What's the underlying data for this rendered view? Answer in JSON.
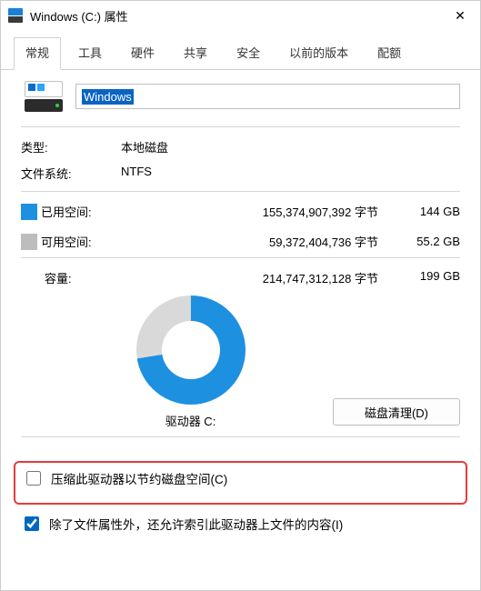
{
  "window": {
    "title": "Windows (C:) 属性"
  },
  "tabs": {
    "items": [
      {
        "label": "常规"
      },
      {
        "label": "工具"
      },
      {
        "label": "硬件"
      },
      {
        "label": "共享"
      },
      {
        "label": "安全"
      },
      {
        "label": "以前的版本"
      },
      {
        "label": "配额"
      }
    ],
    "active_index": 0
  },
  "drive": {
    "name": "Windows",
    "type_label": "类型:",
    "type_value": "本地磁盘",
    "fs_label": "文件系统:",
    "fs_value": "NTFS"
  },
  "usage": {
    "used_label": "已用空间:",
    "used_bytes": "155,374,907,392 字节",
    "used_gb": "144 GB",
    "free_label": "可用空间:",
    "free_bytes": "59,372,404,736 字节",
    "free_gb": "55.2 GB",
    "cap_label": "容量:",
    "cap_bytes": "214,747,312,128 字节",
    "cap_gb": "199 GB",
    "used_color": "#1e90e0",
    "free_color": "#bdbdbd",
    "used_fraction_deg": 261
  },
  "disk_label": "驱动器 C:",
  "cleanup_button": "磁盘清理(D)",
  "options": {
    "compress_label": "压缩此驱动器以节约磁盘空间(C)",
    "compress_checked": false,
    "index_label": "除了文件属性外，还允许索引此驱动器上文件的内容(I)",
    "index_checked": true
  }
}
